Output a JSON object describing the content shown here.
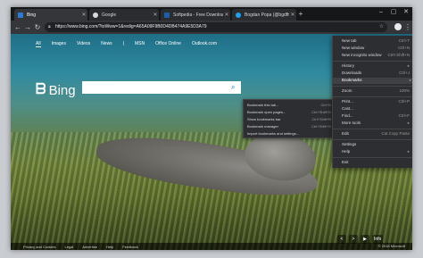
{
  "tabs": [
    {
      "label": "Bing",
      "favicon_color": "#2b7bd3"
    },
    {
      "label": "Google",
      "favicon_color": "#dadada"
    },
    {
      "label": "Softpedia - Free Downloads Enc...",
      "favicon_color": "#1a5fa8"
    },
    {
      "label": "Bogdan Popa (@bgdftw) | Twitter",
      "favicon_color": "#1da1f2"
    }
  ],
  "toolbar": {
    "url": "https://www.bing.com/?toWww=1&redig=A65A09F9B0D4DB474A9E5D3A79"
  },
  "bing": {
    "nav": [
      "All",
      "Images",
      "Videos",
      "News",
      "|",
      "MSN",
      "Office Online",
      "Outlook.com"
    ],
    "logo_text": "Bing",
    "controls": [
      "<",
      ">",
      "▶",
      "Info"
    ]
  },
  "footer": {
    "links": [
      "Privacy and Cookies",
      "Legal",
      "Advertise",
      "Help",
      "Feedback"
    ],
    "copyright": "© 2018 Microsoft"
  },
  "menu": {
    "items": [
      {
        "label": "New tab",
        "shortcut": "Ctrl+T"
      },
      {
        "label": "New window",
        "shortcut": "Ctrl+N"
      },
      {
        "label": "New incognito window",
        "shortcut": "Ctrl+Shift+N"
      },
      {
        "label": "History",
        "shortcut": "▸"
      },
      {
        "label": "Downloads",
        "shortcut": "Ctrl+J"
      },
      {
        "label": "Bookmarks",
        "shortcut": "▸"
      },
      {
        "label": "Zoom",
        "shortcut": "100%"
      },
      {
        "label": "Print...",
        "shortcut": "Ctrl+P"
      },
      {
        "label": "Cast...",
        "shortcut": ""
      },
      {
        "label": "Find...",
        "shortcut": "Ctrl+F"
      },
      {
        "label": "More tools",
        "shortcut": "▸"
      },
      {
        "label": "Edit",
        "shortcut": "Cut  Copy  Paste"
      },
      {
        "label": "Settings",
        "shortcut": ""
      },
      {
        "label": "Help",
        "shortcut": "▸"
      },
      {
        "label": "Exit",
        "shortcut": ""
      }
    ]
  },
  "submenu": {
    "items": [
      {
        "label": "Bookmark this tab...",
        "shortcut": "Ctrl+D"
      },
      {
        "label": "Bookmark open pages...",
        "shortcut": "Ctrl+Shift+D"
      },
      {
        "label": "Show bookmarks bar",
        "shortcut": "Ctrl+Shift+B"
      },
      {
        "label": "Bookmark manager",
        "shortcut": "Ctrl+Shift+O"
      },
      {
        "label": "Import bookmarks and settings...",
        "shortcut": ""
      }
    ]
  }
}
